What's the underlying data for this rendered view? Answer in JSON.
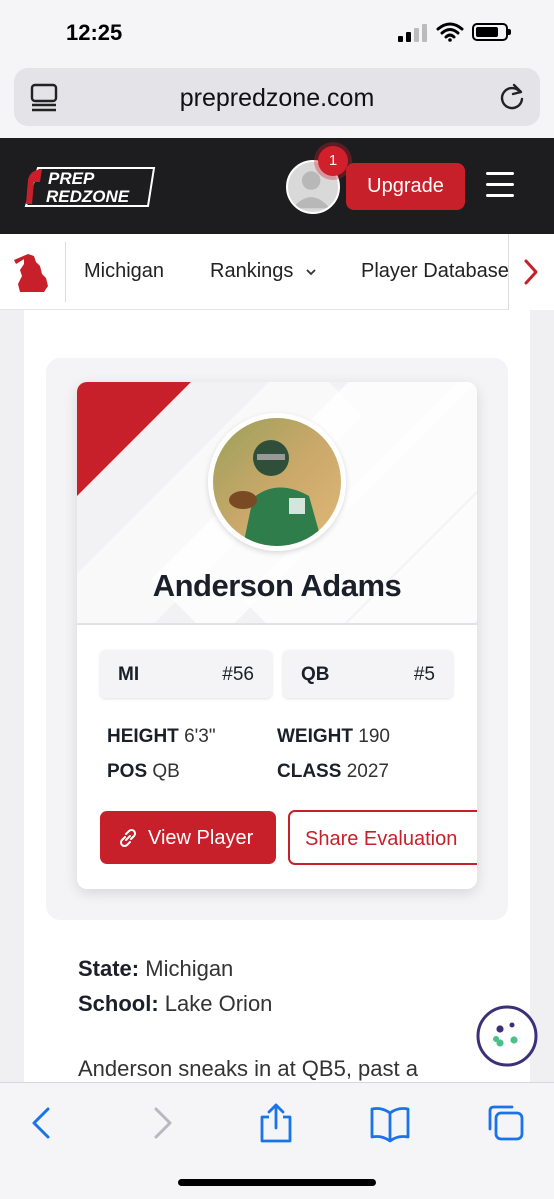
{
  "status_bar": {
    "time": "12:25"
  },
  "browser": {
    "url": "prepredzone.com"
  },
  "header": {
    "logo_text_line1": "PREP",
    "logo_text_line2": "REDZONE",
    "notification_count": "1",
    "upgrade_label": "Upgrade"
  },
  "subnav": {
    "items": [
      {
        "label": "Michigan"
      },
      {
        "label": "Rankings"
      },
      {
        "label": "Player Database"
      }
    ]
  },
  "player": {
    "name": "Anderson Adams",
    "state_rank": {
      "label": "MI",
      "value": "#56"
    },
    "position_rank": {
      "label": "QB",
      "value": "#5"
    },
    "attributes": {
      "height_label": "HEIGHT",
      "height": "6'3\"",
      "weight_label": "WEIGHT",
      "weight": "190",
      "pos_label": "POS",
      "pos": "QB",
      "class_label": "CLASS",
      "class": "2027"
    },
    "view_button": "View Player",
    "share_button": "Share Evaluation"
  },
  "info": {
    "state_label": "State:",
    "state": "Michigan",
    "school_label": "School:",
    "school": "Lake Orion",
    "blurb": "Anderson sneaks in at QB5, past a"
  },
  "colors": {
    "brand_red": "#c8202b",
    "header_dark": "#1d1d1f"
  }
}
